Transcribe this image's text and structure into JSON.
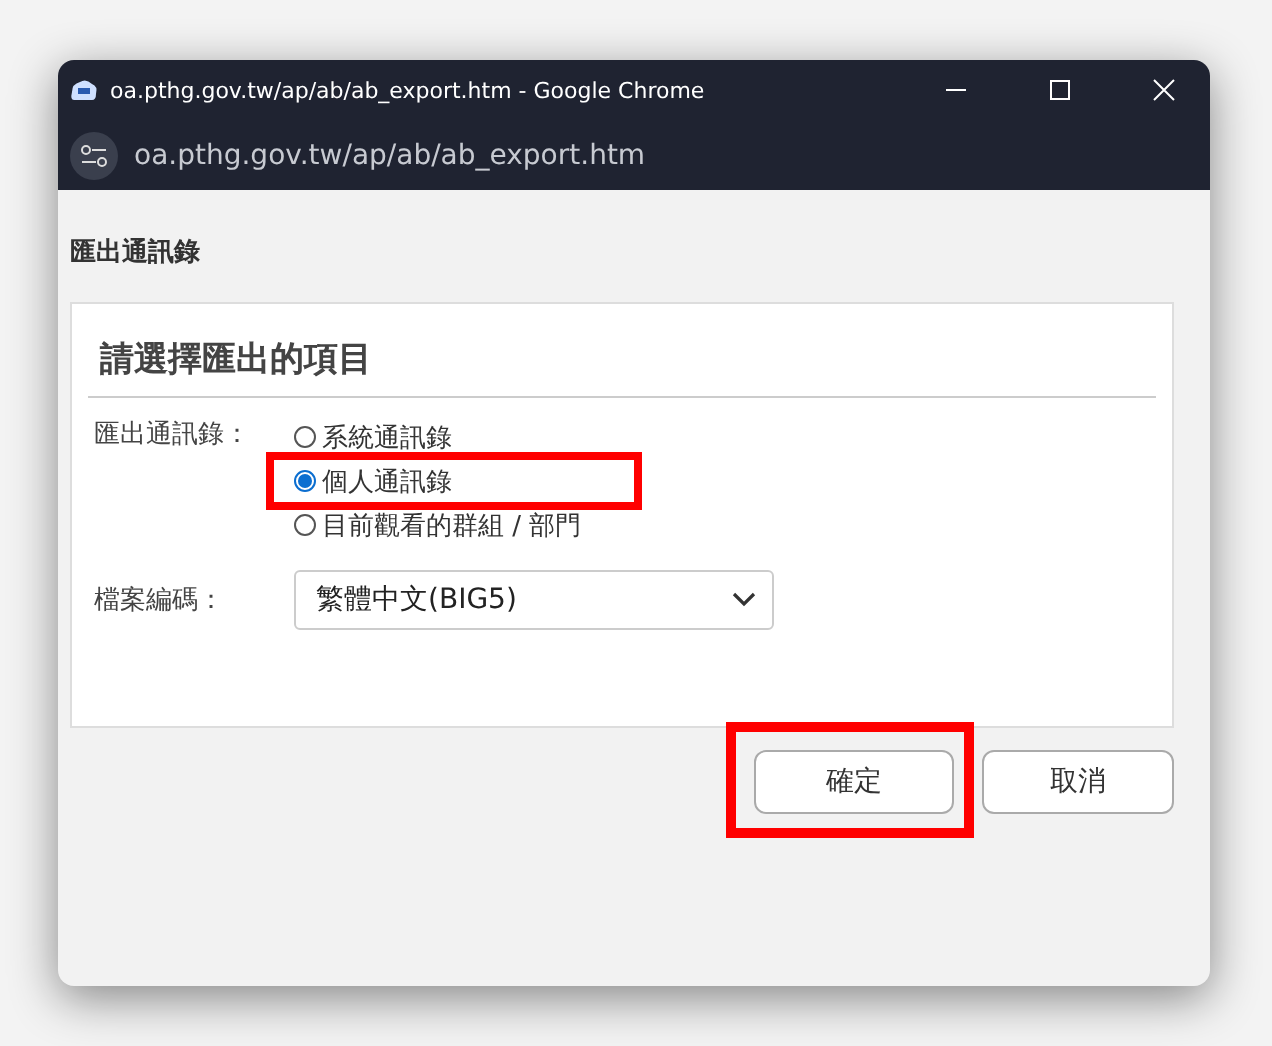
{
  "window": {
    "title": "oa.pthg.gov.tw/ap/ab/ab_export.htm - Google Chrome",
    "address": "oa.pthg.gov.tw/ap/ab/ab_export.htm"
  },
  "page_title": "匯出通訊錄",
  "panel": {
    "heading": "請選擇匯出的項目",
    "export_label": "匯出通訊錄：",
    "options": [
      {
        "label": "系統通訊錄",
        "selected": false,
        "highlighted": false
      },
      {
        "label": "個人通訊錄",
        "selected": true,
        "highlighted": true
      },
      {
        "label": "目前觀看的群組 / 部門",
        "selected": false,
        "highlighted": false
      }
    ],
    "encoding_label": "檔案編碼：",
    "encoding_value": "繁體中文(BIG5)"
  },
  "buttons": [
    {
      "label": "確定",
      "highlighted": true
    },
    {
      "label": "取消",
      "highlighted": false
    }
  ]
}
